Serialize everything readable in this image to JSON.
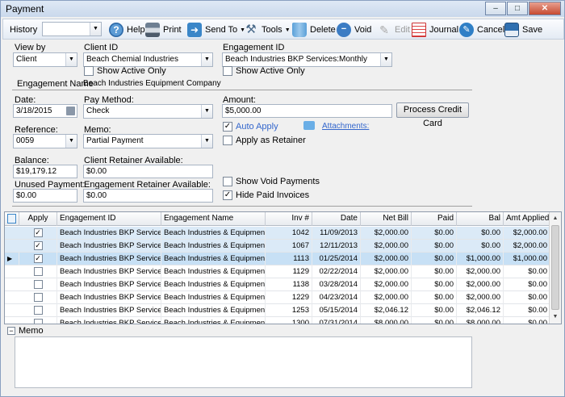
{
  "window": {
    "title": "Payment",
    "min": "–",
    "max": "□",
    "close": "✕"
  },
  "toolbar": {
    "history_label": "History",
    "help_label": "Help",
    "print_label": "Print",
    "sendto_label": "Send To",
    "tools_label": "Tools",
    "delete_label": "Delete",
    "void_label": "Void",
    "edit_label": "Edit",
    "journal_label": "Journal",
    "cancel_label": "Cancel",
    "save_label": "Save",
    "dropdown_glyph": "▼"
  },
  "form": {
    "view_by_label": "View by",
    "view_by_value": "Client",
    "client_id_label": "Client ID",
    "client_id_value": "Beach Chemial Industries",
    "client_show_active": "Show Active Only",
    "engagement_id_label": "Engagement ID",
    "engagement_id_value": "Beach Industries BKP Services:Monthly",
    "engagement_show_active": "Show Active Only",
    "engagement_name_label": "Engagement Name",
    "engagement_name_value": "Beach Industries  Equipment Company",
    "date_label": "Date:",
    "date_value": "3/18/2015",
    "pay_method_label": "Pay Method:",
    "pay_method_value": "Check",
    "amount_label": "Amount:",
    "amount_value": "$5,000.00",
    "process_cc_label": "Process Credit Card",
    "reference_label": "Reference:",
    "reference_value": "0059",
    "memo_label": "Memo:",
    "memo_value": "Partial Payment",
    "auto_apply_label": "Auto Apply",
    "attachments_label": "Attachments:",
    "apply_retainer_label": "Apply as Retainer",
    "balance_label": "Balance:",
    "balance_value": "$19,179.12",
    "client_retainer_label": "Client Retainer Available:",
    "client_retainer_value": "$0.00",
    "unused_payment_label": "Unused Payment:",
    "unused_payment_value": "$0.00",
    "engagement_retainer_label": "Engagement Retainer Available:",
    "engagement_retainer_value": "$0.00",
    "show_void_label": "Show Void Payments",
    "hide_paid_label": "Hide Paid Invoices",
    "check_glyph": "✓"
  },
  "grid": {
    "columns": [
      "Apply",
      "Engagement ID",
      "Engagement Name",
      "Inv #",
      "Date",
      "Net Bill",
      "Paid",
      "Bal",
      "Amt Applied"
    ],
    "rows": [
      {
        "apply": true,
        "eng_id": "Beach Industries BKP Services:Mo",
        "eng_name": "Beach Industries & Equipment Co",
        "inv": "1042",
        "date": "11/09/2013",
        "net": "$2,000.00",
        "paid": "$0.00",
        "bal": "$0.00",
        "applied": "$2,000.00"
      },
      {
        "apply": true,
        "eng_id": "Beach Industries BKP Services:Mo",
        "eng_name": "Beach Industries & Equipment Co",
        "inv": "1067",
        "date": "12/11/2013",
        "net": "$2,000.00",
        "paid": "$0.00",
        "bal": "$0.00",
        "applied": "$2,000.00"
      },
      {
        "apply": true,
        "eng_id": "Beach Industries BKP Services:Mo",
        "eng_name": "Beach Industries & Equipment Co",
        "inv": "1113",
        "date": "01/25/2014",
        "net": "$2,000.00",
        "paid": "$0.00",
        "bal": "$1,000.00",
        "applied": "$1,000.00"
      },
      {
        "apply": false,
        "eng_id": "Beach Industries BKP Services:Mo",
        "eng_name": "Beach Industries & Equipment Co",
        "inv": "1129",
        "date": "02/22/2014",
        "net": "$2,000.00",
        "paid": "$0.00",
        "bal": "$2,000.00",
        "applied": "$0.00"
      },
      {
        "apply": false,
        "eng_id": "Beach Industries BKP Services:Mo",
        "eng_name": "Beach Industries & Equipment Co",
        "inv": "1138",
        "date": "03/28/2014",
        "net": "$2,000.00",
        "paid": "$0.00",
        "bal": "$2,000.00",
        "applied": "$0.00"
      },
      {
        "apply": false,
        "eng_id": "Beach Industries BKP Services:Mo",
        "eng_name": "Beach Industries & Equipment Co",
        "inv": "1229",
        "date": "04/23/2014",
        "net": "$2,000.00",
        "paid": "$0.00",
        "bal": "$2,000.00",
        "applied": "$0.00"
      },
      {
        "apply": false,
        "eng_id": "Beach Industries BKP Services:Mo",
        "eng_name": "Beach Industries & Equipment Co",
        "inv": "1253",
        "date": "05/15/2014",
        "net": "$2,046.12",
        "paid": "$0.00",
        "bal": "$2,046.12",
        "applied": "$0.00"
      },
      {
        "apply": false,
        "eng_id": "Beach Industries BKP Services:Mo",
        "eng_name": "Beach Industries & Equipment Co",
        "inv": "1300",
        "date": "07/31/2014",
        "net": "$8,000.00",
        "paid": "$0.00",
        "bal": "$8,000.00",
        "applied": "$0.00"
      }
    ],
    "current_row_marker": "▶",
    "scroll_up": "▲",
    "scroll_down": "▼"
  },
  "memo_section": {
    "label": "Memo",
    "collapse_glyph": "−"
  },
  "colors": {
    "accent": "#3366cc",
    "row_selected": "#dbeaf7",
    "row_current": "#c7e0f5"
  }
}
